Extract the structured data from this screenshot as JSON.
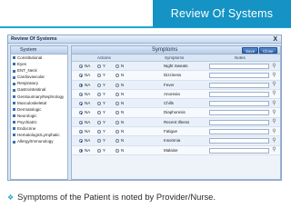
{
  "slide": {
    "title": "Review Of Systems",
    "bullet_text": "Symptoms of the Patient is noted by Provider/Nurse.",
    "accent_color": "#1493c4"
  },
  "window": {
    "title": "Review Of Systems",
    "close_glyph": "X"
  },
  "system_pane": {
    "header": "System",
    "items": [
      "Constitutional",
      "Eyes",
      "ENT_Neck",
      "Cardiovascular",
      "Respiratory",
      "Gastrointestinal",
      "Genitourinary/Nephrology",
      "Musculoskeletal",
      "Dermatologic",
      "Neurologic",
      "Psychiatric",
      "Endocrine",
      "Hematologic/Lymphatic",
      "Allergy/Immunology"
    ],
    "selected_index": 0
  },
  "symptoms_pane": {
    "header": "Symptoms",
    "save_label": "Save",
    "close_label": "Close",
    "columns": {
      "actions": "Actions",
      "symptoms": "Symptoms",
      "notes": "Notes"
    },
    "option_labels": [
      "NA",
      "Y",
      "N"
    ],
    "lookup_icon": "magnifier-icon",
    "rows": [
      {
        "symptom": "Night Sweats",
        "selected": "NA"
      },
      {
        "symptom": "Dizziness",
        "selected": "NA"
      },
      {
        "symptom": "Fever",
        "selected": "NA"
      },
      {
        "symptom": "Anorexia",
        "selected": "NA"
      },
      {
        "symptom": "Chills",
        "selected": "NA"
      },
      {
        "symptom": "Diaphoresis",
        "selected": "NA"
      },
      {
        "symptom": "Recent Illness",
        "selected": "NA"
      },
      {
        "symptom": "Fatigue",
        "selected": "NA"
      },
      {
        "symptom": "Insomnia",
        "selected": "NA"
      },
      {
        "symptom": "Malaise",
        "selected": "NA"
      }
    ]
  }
}
